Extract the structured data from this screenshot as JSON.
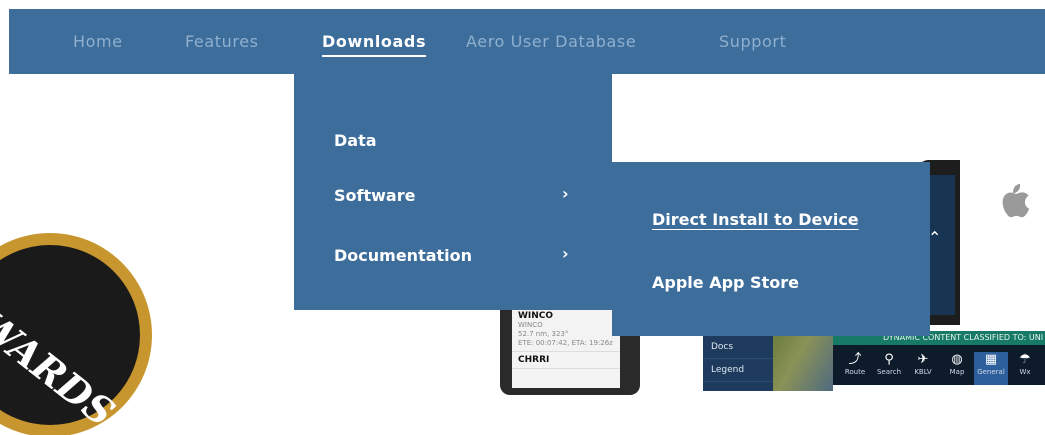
{
  "nav": {
    "items": [
      {
        "label": "Home"
      },
      {
        "label": "Features"
      },
      {
        "label": "Downloads"
      },
      {
        "label": "Aero User Database"
      },
      {
        "label": "Support"
      }
    ]
  },
  "downloads_menu": {
    "items": [
      {
        "label": "Data"
      },
      {
        "label": "Software"
      },
      {
        "label": "Documentation"
      }
    ]
  },
  "software_submenu": {
    "items": [
      {
        "label": "Direct Install to Device"
      },
      {
        "label": "Apple App Store"
      }
    ]
  },
  "background": {
    "badge_text": "WARDS",
    "phone_list": [
      {
        "name": "WINCO",
        "sub1": "WINCO",
        "sub2": "52.7 nm, 323°",
        "sub3": "ETE: 00:07:42, ETA: 19:26z"
      },
      {
        "name": "CHRRI"
      }
    ],
    "side_items": [
      "Docs",
      "Legend"
    ],
    "banner": "DYNAMIC CONTENT CLASSIFIED TO: UNI",
    "tabs": [
      "Route",
      "Search",
      "KBLV",
      "Map",
      "General",
      "Wx"
    ]
  },
  "colors": {
    "nav_bg": "#3d6d9b",
    "nav_text": "#8fb0cf",
    "menu_text": "#ffffff"
  }
}
